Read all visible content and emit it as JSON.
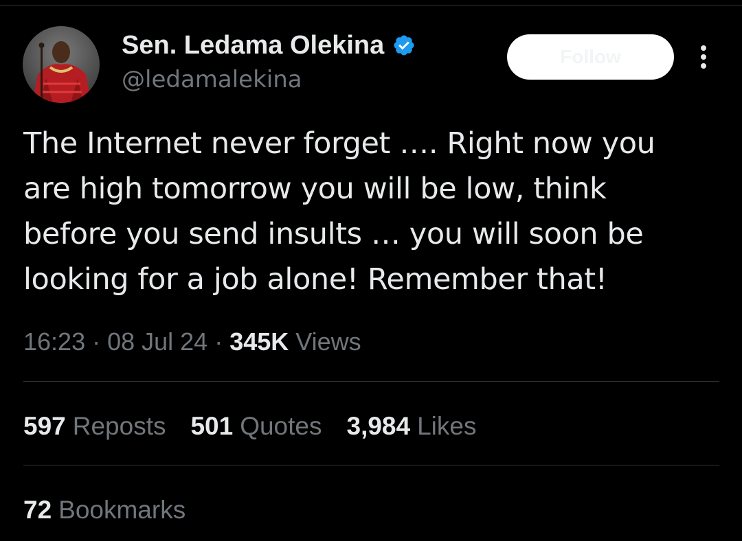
{
  "author": {
    "display_name": "Sen. Ledama Olekina",
    "handle": "@ledamalekina",
    "verified_icon": "verified-badge-icon",
    "avatar_icon": "profile-photo"
  },
  "follow_button": {
    "label": "Follow"
  },
  "more_icon": "more-options-icon",
  "tweet": {
    "text": "The Internet never forget …. Right now you\nare high tomorrow you will be low, think\nbefore you send insults … you will soon be\nlooking for a job alone! Remember that!"
  },
  "meta": {
    "time": "16:23",
    "sep1": " · ",
    "date": "08 Jul 24",
    "sep2": " · ",
    "views_count": "345K",
    "views_label": "Views"
  },
  "stats": {
    "reposts_count": "597",
    "reposts_label": "Reposts",
    "quotes_count": "501",
    "quotes_label": "Quotes",
    "likes_count": "3,984",
    "likes_label": "Likes",
    "bookmarks_count": "72",
    "bookmarks_label": "Bookmarks"
  },
  "colors": {
    "background": "#000000",
    "primary_text": "#e7e9ea",
    "secondary_text": "#71767b",
    "divider": "#2f3336",
    "verified_blue": "#1d9bf0",
    "follow_bg": "#ffffff"
  }
}
